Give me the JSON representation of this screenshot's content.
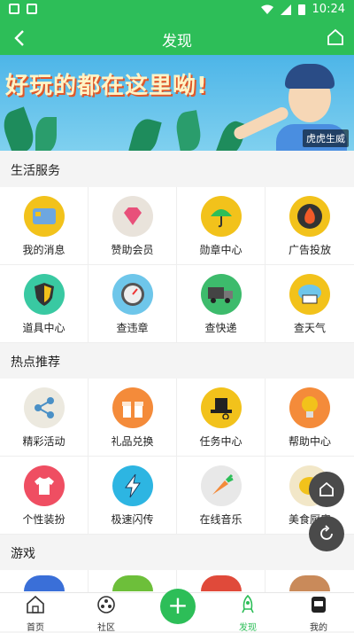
{
  "status": {
    "time": "10:24"
  },
  "header": {
    "title": "发现"
  },
  "banner": {
    "headline": "好玩的都在这里呦!",
    "author": "虎虎生威"
  },
  "sections": [
    {
      "title": "生活服务",
      "items": [
        {
          "label": "我的消息",
          "icon": "card-icon",
          "color": "#f2c21b"
        },
        {
          "label": "赞助会员",
          "icon": "diamond-icon",
          "color": "#e9e3db"
        },
        {
          "label": "勋章中心",
          "icon": "umbrella-icon",
          "color": "#f2c21b"
        },
        {
          "label": "广告投放",
          "icon": "fire-icon",
          "color": "#f2c21b"
        },
        {
          "label": "道具中心",
          "icon": "shield-icon",
          "color": "#39c9a2"
        },
        {
          "label": "查违章",
          "icon": "gauge-icon",
          "color": "#6ec6ea"
        },
        {
          "label": "查快递",
          "icon": "truck-icon",
          "color": "#3dbb6c"
        },
        {
          "label": "查天气",
          "icon": "cloud-icon",
          "color": "#f2c21b"
        }
      ]
    },
    {
      "title": "热点推荐",
      "items": [
        {
          "label": "精彩活动",
          "icon": "share-icon",
          "color": "#ece9df"
        },
        {
          "label": "礼品兑换",
          "icon": "gift-icon",
          "color": "#f48b3a"
        },
        {
          "label": "任务中心",
          "icon": "tophat-icon",
          "color": "#f2c21b"
        },
        {
          "label": "帮助中心",
          "icon": "lightbulb-icon",
          "color": "#f48b3a"
        },
        {
          "label": "个性装扮",
          "icon": "shirt-icon",
          "color": "#ef4e62"
        },
        {
          "label": "极速闪传",
          "icon": "lightning-icon",
          "color": "#2db5e2"
        },
        {
          "label": "在线音乐",
          "icon": "carrot-icon",
          "color": "#e8e8e8"
        },
        {
          "label": "美食厨房",
          "icon": "lemon-icon",
          "color": "#f2e7c8"
        }
      ]
    },
    {
      "title": "游戏"
    }
  ],
  "nav": {
    "home": "首页",
    "community": "社区",
    "discover": "发现",
    "mine": "我的"
  }
}
